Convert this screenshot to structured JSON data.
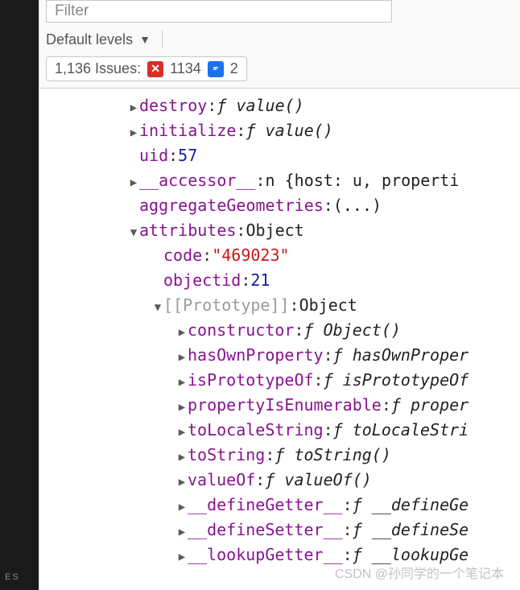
{
  "toolbar": {
    "filter_placeholder": "Filter",
    "levels_label": "Default levels",
    "issues_label": "1,136 Issues:",
    "error_count": "1134",
    "info_count": "2"
  },
  "console": {
    "lines": [
      {
        "indent": 1,
        "arrow": "right",
        "key": "destroy",
        "kind": "fn",
        "val": "value()"
      },
      {
        "indent": 1,
        "arrow": "right",
        "key": "initialize",
        "kind": "fn",
        "val": "value()"
      },
      {
        "indent": 1,
        "arrow": "",
        "key": "uid",
        "kind": "num",
        "val": "57"
      },
      {
        "indent": 1,
        "arrow": "right",
        "key": "__accessor__",
        "kind": "obj",
        "val": "n {host: u, properti"
      },
      {
        "indent": 1,
        "arrow": "",
        "key": "aggregateGeometries",
        "kind": "obj",
        "val": "(...)"
      },
      {
        "indent": 1,
        "arrow": "down",
        "key": "attributes",
        "kind": "obj",
        "val": "Object"
      },
      {
        "indent": 2,
        "arrow": "",
        "key": "code",
        "kind": "str",
        "val": "\"469023\""
      },
      {
        "indent": 2,
        "arrow": "",
        "key": "objectid",
        "kind": "num",
        "val": "21"
      },
      {
        "indent": 2,
        "arrow": "down",
        "key": "[[Prototype]]",
        "dim": true,
        "kind": "obj",
        "val": "Object"
      },
      {
        "indent": 3,
        "arrow": "right",
        "key": "constructor",
        "kind": "fn",
        "val": "Object()"
      },
      {
        "indent": 3,
        "arrow": "right",
        "key": "hasOwnProperty",
        "kind": "fn",
        "val": "hasOwnProper"
      },
      {
        "indent": 3,
        "arrow": "right",
        "key": "isPrototypeOf",
        "kind": "fn",
        "val": "isPrototypeOf"
      },
      {
        "indent": 3,
        "arrow": "right",
        "key": "propertyIsEnumerable",
        "kind": "fn",
        "val": "proper"
      },
      {
        "indent": 3,
        "arrow": "right",
        "key": "toLocaleString",
        "kind": "fn",
        "val": "toLocaleStri"
      },
      {
        "indent": 3,
        "arrow": "right",
        "key": "toString",
        "kind": "fn",
        "val": "toString()"
      },
      {
        "indent": 3,
        "arrow": "right",
        "key": "valueOf",
        "kind": "fn",
        "val": "valueOf()"
      },
      {
        "indent": 3,
        "arrow": "right",
        "key": "__defineGetter__",
        "kind": "fn",
        "val": "__defineGe"
      },
      {
        "indent": 3,
        "arrow": "right",
        "key": "__defineSetter__",
        "kind": "fn",
        "val": "__defineSe"
      },
      {
        "indent": 3,
        "arrow": "right",
        "key": "__lookupGetter__",
        "kind": "fn",
        "val": "__lookupGe"
      }
    ]
  },
  "watermark": "CSDN @孙同学的一个笔记本",
  "sidebar_text": "ES"
}
